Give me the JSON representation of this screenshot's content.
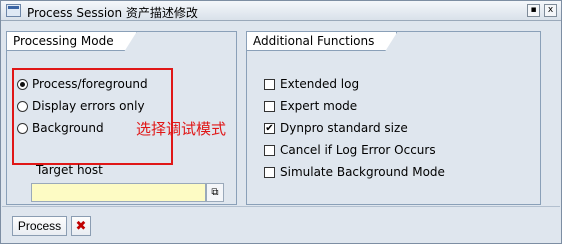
{
  "window": {
    "title": "Process Session 资产描述修改",
    "close_glyph": "x"
  },
  "processing_mode": {
    "header": "Processing Mode",
    "options": [
      {
        "label": "Process/foreground",
        "selected": true
      },
      {
        "label": "Display errors only",
        "selected": false
      },
      {
        "label": "Background",
        "selected": false
      }
    ],
    "annotation": "选择调试模式",
    "target_host_label": "Target host",
    "target_host_value": ""
  },
  "additional_functions": {
    "header": "Additional Functions",
    "options": [
      {
        "label": "Extended log",
        "checked": false
      },
      {
        "label": "Expert mode",
        "checked": false
      },
      {
        "label": "Dynpro standard size",
        "checked": true
      },
      {
        "label": "Cancel if Log Error Occurs",
        "checked": false
      },
      {
        "label": "Simulate Background Mode",
        "checked": false
      }
    ]
  },
  "footer": {
    "process_label": "Process",
    "cancel_glyph": "✖"
  },
  "colors": {
    "window_bg": "#dfe6ee",
    "annotation_red": "#e01717",
    "input_bg": "#fdfbc4",
    "cancel_red": "#c00000"
  }
}
